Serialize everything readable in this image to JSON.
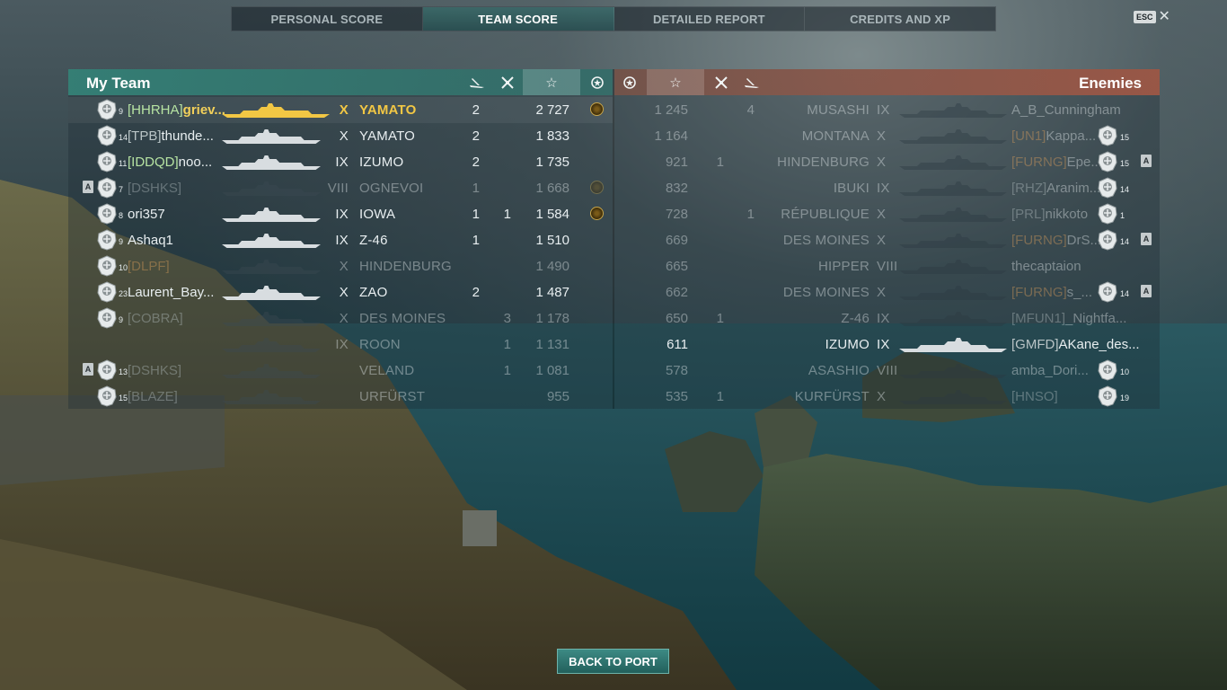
{
  "tabs": [
    "PERSONAL SCORE",
    "TEAM SCORE",
    "DETAILED REPORT",
    "CREDITS AND XP"
  ],
  "active_tab": 1,
  "esc_label": "ESC",
  "close_symbol": "✕",
  "my_team": {
    "title": "My Team",
    "header_icons": [
      "ship-sunk-icon",
      "plane-destroyed-icon",
      "star-icon",
      "medal-icon"
    ],
    "rows": [
      {
        "level": "9",
        "clan": "[HHRHA]",
        "name": "griev...",
        "tier": "X",
        "ship": "YAMATO",
        "kills": "2",
        "planes": "",
        "score": "2 727",
        "medal": true,
        "dim": false,
        "me": true,
        "clan_color": "green",
        "badge": ""
      },
      {
        "level": "14",
        "clan": "[TPB]",
        "name": "thunde...",
        "tier": "X",
        "ship": "YAMATO",
        "kills": "2",
        "planes": "",
        "score": "1 833",
        "medal": false,
        "dim": false,
        "me": false,
        "clan_color": "grey",
        "badge": ""
      },
      {
        "level": "11",
        "clan": "[IDDQD]",
        "name": "noo...",
        "tier": "IX",
        "ship": "IZUMO",
        "kills": "2",
        "planes": "",
        "score": "1 735",
        "medal": false,
        "dim": false,
        "me": false,
        "clan_color": "green",
        "badge": ""
      },
      {
        "level": "7",
        "clan": "[DSHKS]",
        "name": "",
        "tier": "VIII",
        "ship": "OGNEVOI",
        "kills": "1",
        "planes": "",
        "score": "1 668",
        "medal": true,
        "dim": true,
        "me": false,
        "clan_color": "grey",
        "badge": "A"
      },
      {
        "level": "8",
        "clan": "",
        "name": "ori357",
        "tier": "IX",
        "ship": "IOWA",
        "kills": "1",
        "planes": "1",
        "score": "1 584",
        "medal": true,
        "dim": false,
        "me": false,
        "clan_color": "grey",
        "badge": ""
      },
      {
        "level": "9",
        "clan": "",
        "name": "Ashaq1",
        "tier": "IX",
        "ship": "Z-46",
        "kills": "1",
        "planes": "",
        "score": "1 510",
        "medal": false,
        "dim": false,
        "me": false,
        "clan_color": "grey",
        "badge": ""
      },
      {
        "level": "10",
        "clan": "[DLPF]",
        "name": "",
        "tier": "X",
        "ship": "HINDENBURG",
        "kills": "",
        "planes": "",
        "score": "1 490",
        "medal": false,
        "dim": true,
        "me": false,
        "clan_color": "orange",
        "badge": ""
      },
      {
        "level": "23",
        "clan": "",
        "name": "Laurent_Bay...",
        "tier": "X",
        "ship": "ZAO",
        "kills": "2",
        "planes": "",
        "score": "1 487",
        "medal": false,
        "dim": false,
        "me": false,
        "clan_color": "grey",
        "badge": ""
      },
      {
        "level": "9",
        "clan": "[COBRA]",
        "name": "",
        "tier": "X",
        "ship": "DES MOINES",
        "kills": "",
        "planes": "3",
        "score": "1 178",
        "medal": false,
        "dim": true,
        "me": false,
        "clan_color": "grey",
        "badge": ""
      },
      {
        "level": "",
        "clan": "",
        "name": "",
        "tier": "IX",
        "ship": "ROON",
        "kills": "",
        "planes": "1",
        "score": "1 131",
        "medal": false,
        "dim": true,
        "me": false,
        "clan_color": "grey",
        "badge": ""
      },
      {
        "level": "13",
        "clan": "[DSHKS]",
        "name": "",
        "tier": "",
        "ship": "VELAND",
        "kills": "",
        "planes": "1",
        "score": "1 081",
        "medal": false,
        "dim": true,
        "me": false,
        "clan_color": "grey",
        "badge": "A"
      },
      {
        "level": "15",
        "clan": "[BLAZE]",
        "name": "",
        "tier": "",
        "ship": "URFÜRST",
        "kills": "",
        "planes": "",
        "score": "955",
        "medal": false,
        "dim": true,
        "me": false,
        "clan_color": "grey",
        "badge": ""
      }
    ]
  },
  "enemies": {
    "title": "Enemies",
    "header_icons": [
      "medal-icon",
      "star-icon",
      "plane-destroyed-icon",
      "ship-sunk-icon"
    ],
    "rows": [
      {
        "score": "1 245",
        "planes": "",
        "kills": "4",
        "ship": "MUSASHI",
        "tier": "IX",
        "clan": "",
        "name": "A_B_Cunningham",
        "level": "",
        "badge": "",
        "dim": true,
        "clan_color": "grey"
      },
      {
        "score": "1 164",
        "planes": "",
        "kills": "",
        "ship": "MONTANA",
        "tier": "X",
        "clan": "[UN1]",
        "name": "Kappa...",
        "level": "15",
        "badge": "",
        "dim": true,
        "clan_color": "orange"
      },
      {
        "score": "921",
        "planes": "1",
        "kills": "",
        "ship": "HINDENBURG",
        "tier": "X",
        "clan": "[FURNG]",
        "name": "Epe...",
        "level": "15",
        "badge": "A",
        "dim": true,
        "clan_color": "orange"
      },
      {
        "score": "832",
        "planes": "",
        "kills": "",
        "ship": "IBUKI",
        "tier": "IX",
        "clan": "[RHZ]",
        "name": "Aranim...",
        "level": "14",
        "badge": "",
        "dim": true,
        "clan_color": "grey"
      },
      {
        "score": "728",
        "planes": "",
        "kills": "1",
        "ship": "RÉPUBLIQUE",
        "tier": "X",
        "clan": "[PRL]",
        "name": "nikkoto",
        "level": "1",
        "badge": "",
        "dim": true,
        "clan_color": "grey"
      },
      {
        "score": "669",
        "planes": "",
        "kills": "",
        "ship": "DES MOINES",
        "tier": "X",
        "clan": "[FURNG]",
        "name": "DrS...",
        "level": "14",
        "badge": "A",
        "dim": true,
        "clan_color": "orange"
      },
      {
        "score": "665",
        "planes": "",
        "kills": "",
        "ship": "HIPPER",
        "tier": "VIII",
        "clan": "",
        "name": "thecaptaion",
        "level": "",
        "badge": "",
        "dim": true,
        "clan_color": "grey"
      },
      {
        "score": "662",
        "planes": "",
        "kills": "",
        "ship": "DES MOINES",
        "tier": "X",
        "clan": "[FURNG]",
        "name": "s_...",
        "level": "14",
        "badge": "A",
        "dim": true,
        "clan_color": "orange"
      },
      {
        "score": "650",
        "planes": "1",
        "kills": "",
        "ship": "Z-46",
        "tier": "IX",
        "clan": "[MFUN1]",
        "name": "_Nightfa...",
        "level": "",
        "badge": "",
        "dim": true,
        "clan_color": "grey"
      },
      {
        "score": "611",
        "planes": "",
        "kills": "",
        "ship": "IZUMO",
        "tier": "IX",
        "clan": "[GMFD]",
        "name": "AKane_des...",
        "level": "",
        "badge": "",
        "dim": false,
        "clan_color": "grey"
      },
      {
        "score": "578",
        "planes": "",
        "kills": "",
        "ship": "ASASHIO",
        "tier": "VIII",
        "clan": "",
        "name": "amba_Dori...",
        "level": "10",
        "badge": "",
        "dim": true,
        "clan_color": "grey"
      },
      {
        "score": "535",
        "planes": "1",
        "kills": "",
        "ship": "KURFÜRST",
        "tier": "X",
        "clan": "[HNSO]",
        "name": "",
        "level": "19",
        "badge": "",
        "dim": true,
        "clan_color": "grey"
      }
    ]
  },
  "back_button": "BACK TO PORT"
}
